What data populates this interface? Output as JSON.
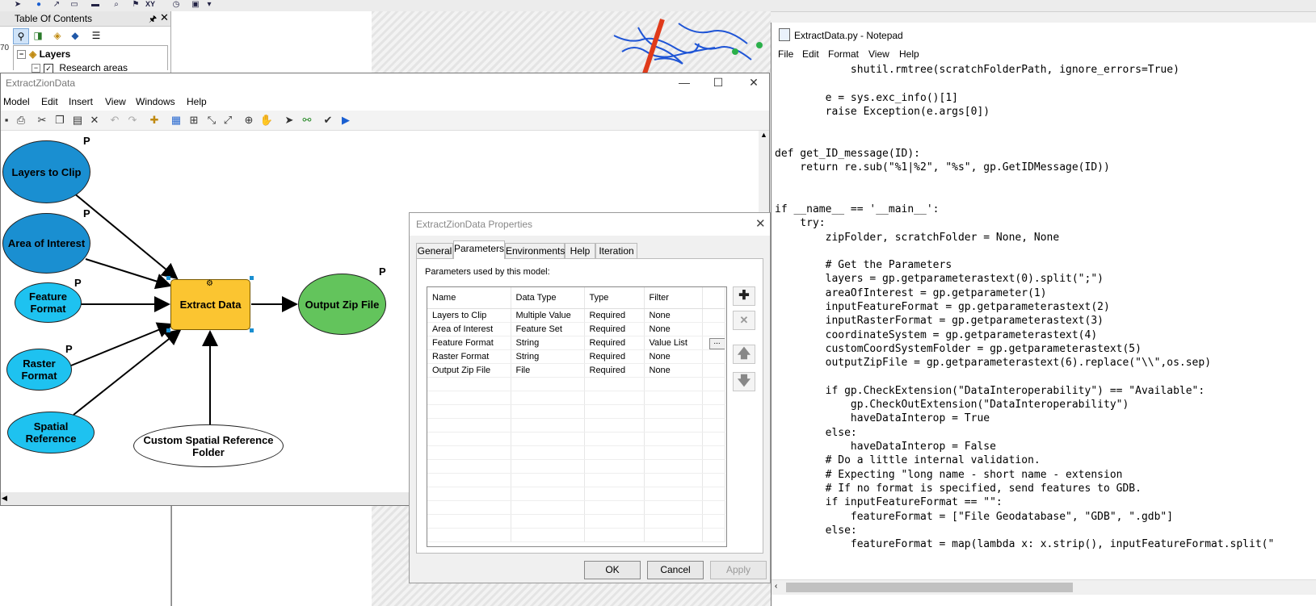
{
  "toc": {
    "title": "Table Of Contents",
    "layers_label": "Layers",
    "research_areas": "Research areas",
    "side_num": "70"
  },
  "modelbuilder": {
    "title": "ExtractZionData",
    "menu": [
      "Model",
      "Edit",
      "Insert",
      "View",
      "Windows",
      "Help"
    ],
    "nodes": {
      "layers_to_clip": "Layers to Clip",
      "area_of_interest": "Area of Interest",
      "feature_format": "Feature Format",
      "raster_format": "Raster Format",
      "spatial_reference": "Spatial Reference",
      "extract_data": "Extract Data",
      "output_zip_file": "Output Zip File",
      "custom_spatial_reference_folder": "Custom Spatial Reference Folder"
    },
    "param_marker": "P"
  },
  "dialog": {
    "title": "ExtractZionData Properties",
    "tabs": [
      "General",
      "Parameters",
      "Environments",
      "Help",
      "Iteration"
    ],
    "caption": "Parameters used by this model:",
    "columns": [
      "Name",
      "Data Type",
      "Type",
      "Filter"
    ],
    "rows": [
      {
        "name": "Layers to Clip",
        "data_type": "Multiple Value",
        "type": "Required",
        "filter": "None"
      },
      {
        "name": "Area of Interest",
        "data_type": "Feature Set",
        "type": "Required",
        "filter": "None"
      },
      {
        "name": "Feature Format",
        "data_type": "String",
        "type": "Required",
        "filter": "Value List"
      },
      {
        "name": "Raster Format",
        "data_type": "String",
        "type": "Required",
        "filter": "None"
      },
      {
        "name": "Output Zip File",
        "data_type": "File",
        "type": "Required",
        "filter": "None"
      }
    ],
    "ellipsis": "...",
    "buttons": {
      "ok": "OK",
      "cancel": "Cancel",
      "apply": "Apply"
    }
  },
  "notepad": {
    "title": "ExtractData.py - Notepad",
    "menu": [
      "File",
      "Edit",
      "Format",
      "View",
      "Help"
    ],
    "code": "            shutil.rmtree(scratchFolderPath, ignore_errors=True)\n\n        e = sys.exc_info()[1]\n        raise Exception(e.args[0])\n\n\ndef get_ID_message(ID):\n    return re.sub(\"%1|%2\", \"%s\", gp.GetIDMessage(ID))\n\n\nif __name__ == '__main__':\n    try:\n        zipFolder, scratchFolder = None, None\n\n        # Get the Parameters\n        layers = gp.getparameterastext(0).split(\";\")\n        areaOfInterest = gp.getparameter(1)\n        inputFeatureFormat = gp.getparameterastext(2)\n        inputRasterFormat = gp.getparameterastext(3)\n        coordinateSystem = gp.getparameterastext(4)\n        customCoordSystemFolder = gp.getparameterastext(5)\n        outputZipFile = gp.getparameterastext(6).replace(\"\\\\\",os.sep)\n\n        if gp.CheckExtension(\"DataInteroperability\") == \"Available\":\n            gp.CheckOutExtension(\"DataInteroperability\")\n            haveDataInterop = True\n        else:\n            haveDataInterop = False\n        # Do a little internal validation.\n        # Expecting \"long name - short name - extension\n        # If no format is specified, send features to GDB.\n        if inputFeatureFormat == \"\":\n            featureFormat = [\"File Geodatabase\", \"GDB\", \".gdb\"]\n        else:\n            featureFormat = map(lambda x: x.strip(), inputFeatureFormat.split(\""
  },
  "colors": {
    "dark_blue_node": "#1a8fd1",
    "light_blue_node": "#1ec2f0",
    "tool_node": "#fbc531",
    "output_node": "#63c45c",
    "river_blue": "#1f55d6",
    "road_red": "#e03a1a"
  }
}
